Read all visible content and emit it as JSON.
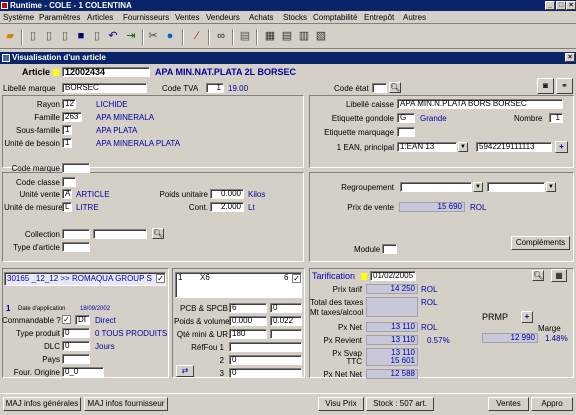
{
  "window": {
    "title": "Runtime - COLE -   1  COLENTINA"
  },
  "menu": [
    "Système",
    "Paramètres",
    "Articles",
    "Fournisseurs",
    "Ventes",
    "Vendeurs",
    "Achats",
    "Stocks",
    "Comptabilité",
    "Entrepôt",
    "Autres"
  ],
  "child_title": "Visualisation d'un article",
  "article": {
    "label": "Article",
    "code": "12002434",
    "name": "APA MIN.NAT.PLATA 2L BORSEC"
  },
  "libelle_marque": {
    "label": "Libellé marque",
    "value": "BORSEC"
  },
  "code_tva": {
    "label": "Code TVA",
    "code": "1",
    "rate": "19.00"
  },
  "code_etat": {
    "label": "Code état"
  },
  "rayon": {
    "label": "Rayon",
    "code": "12",
    "name": "LICHIDE"
  },
  "famille": {
    "label": "Famille",
    "code": "263",
    "name": "APA MINERALA"
  },
  "sous_famille": {
    "label": "Sous-famille",
    "code": "1",
    "name": "APA PLATA"
  },
  "unite_besoin": {
    "label": "Unité de besoin",
    "code": "1",
    "name": "APA MINERALA PLATA"
  },
  "libelle_caisse": {
    "label": "Libellé caisse",
    "value": "APA MIN.N.PLATA BORS BORSEC"
  },
  "etiquette_gondole": {
    "label": "Etiquette gondole",
    "code": "G",
    "name": "Grande"
  },
  "nombre": {
    "label": "Nombre",
    "value": "1"
  },
  "etiquette_marquage": {
    "label": "Etiquette marquage"
  },
  "ean": {
    "label": "1 EAN, principal",
    "type": "1:EAN 13",
    "value": "5942219111113"
  },
  "code_marque": {
    "label": "Code marque"
  },
  "code_classe": {
    "label": "Code classe"
  },
  "unite_vente": {
    "label": "Unité vente",
    "code": "A",
    "name": "ARTICLE"
  },
  "unite_mesure": {
    "label": "Unité de mesure",
    "code": "L",
    "name": "LITRE"
  },
  "poids_unitaire": {
    "label": "Poids unitaire",
    "value": "0.000",
    "unit": "Kilos"
  },
  "cont": {
    "label": "Cont.",
    "value": "2.000",
    "unit": "Lt"
  },
  "regroupement": {
    "label": "Regroupement"
  },
  "prix_vente": {
    "label": "Prix de vente",
    "value": "15 690",
    "currency": "ROL"
  },
  "collection": {
    "label": "Collection"
  },
  "type_article": {
    "label": "Type d'article"
  },
  "module": {
    "label": "Module"
  },
  "complements_button": "Compléments",
  "supplier": {
    "text": "30165  _12_12 >> ROMAQUA GROUP S",
    "checked": "✓"
  },
  "supplier_count": "1",
  "date_application": {
    "label": "Date d'application",
    "value": "18/09/2002"
  },
  "commandable": {
    "label": "Commandable ?",
    "checked": "✓",
    "code": "DI",
    "name": "Direct"
  },
  "type_produit": {
    "label": "Type produit",
    "code": "0",
    "name": "0 TOUS PRODUITS"
  },
  "dlc": {
    "label": "DLC",
    "code": "0",
    "name": "Jours"
  },
  "pays": {
    "label": "Pays"
  },
  "four_origine": {
    "label": "Four. Origine",
    "value": "0_0"
  },
  "pack": {
    "qty": "1",
    "x": "X6",
    "count": "6",
    "checked": "✓"
  },
  "pcb": {
    "label": "PCB & SPCB",
    "v1": "6",
    "v2": "0"
  },
  "poids_volume": {
    "label": "Poids & volume",
    "v1": "0.000",
    "v2": "0.022"
  },
  "qte_mini": {
    "label": "Qté mini & UR",
    "v1": "180",
    "v2": ""
  },
  "reffou": [
    {
      "label": "RéfFou 1",
      "value": ""
    },
    {
      "label": "2",
      "value": "0"
    },
    {
      "label": "3",
      "value": "0"
    }
  ],
  "tarification": {
    "label": "Tarification",
    "date": "01/02/2005"
  },
  "prix_tarif": {
    "label": "Prix tarif",
    "value": "14 250",
    "currency": "ROL"
  },
  "total_taxes": {
    "label": "Total des taxes",
    "value": "",
    "currency": "ROL"
  },
  "mt_taxes": {
    "label": "Mt taxes/alcool",
    "value": ""
  },
  "px_net": {
    "label": "Px Net",
    "value": "13 110",
    "currency": "ROL"
  },
  "px_revient": {
    "label": "Px Revient",
    "value": "13 110",
    "pct": "0.57%"
  },
  "px_svap": {
    "label": "Px Svap",
    "label2": "TTC",
    "value": "13 110",
    "value2": "15 601"
  },
  "px_net_net": {
    "label": "Px Net Net",
    "value": "12 588"
  },
  "prmp": {
    "label": "PRMP",
    "value": "12 990"
  },
  "marge": {
    "label": "Marge",
    "value": "1.48%"
  },
  "bottom": {
    "maj_generales": "MAJ infos générales",
    "maj_fournisseur": "MAJ infos fournisseur",
    "visu_prix": "Visu Prix",
    "stock": "Stock : 507 art.",
    "ventes": "Ventes",
    "appro": "Appro"
  },
  "colors": {
    "title_bg": "#0a246a",
    "face": "#d4d0c8",
    "value_blue": "#0000a0",
    "readonly": "#c8c8d8"
  }
}
